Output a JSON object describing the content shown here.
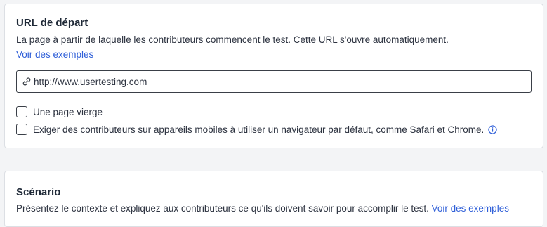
{
  "start_url": {
    "title": "URL de départ",
    "description": "La page à partir de laquelle les contributeurs commencent le test. Cette URL s'ouvre automatiquement.",
    "examples_link": "Voir des exemples",
    "url_value": "http://www.usertesting.com",
    "options": [
      {
        "label": "Une page vierge",
        "checked": false
      },
      {
        "label": "Exiger des contributeurs sur appareils mobiles à utiliser un navigateur par défaut, comme Safari et Chrome.",
        "checked": false
      }
    ],
    "info_icon": "info-icon"
  },
  "scenario": {
    "title": "Scénario",
    "description": "Présentez le contexte et expliquez aux contributeurs ce qu'ils doivent savoir pour accomplir le test.",
    "examples_link": "Voir des exemples"
  },
  "colors": {
    "link": "#2f5fd8",
    "border": "#dcdfe4",
    "text": "#1f2937"
  }
}
